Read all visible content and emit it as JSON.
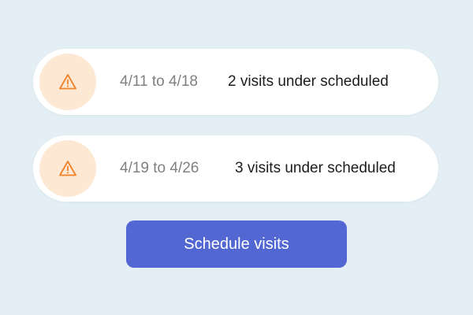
{
  "colors": {
    "background": "#e3eff4",
    "card": "#ffffff",
    "warning_icon": "#f0812a",
    "warning_badge": "#fde8d3",
    "button": "#5367d3",
    "button_text": "#ffffff"
  },
  "alerts": [
    {
      "icon": "warning-triangle-icon",
      "date_range": "4/11 to 4/18",
      "message": "2 visits under scheduled"
    },
    {
      "icon": "warning-triangle-icon",
      "date_range": "4/19 to 4/26",
      "message": "3 visits under scheduled"
    }
  ],
  "actions": {
    "schedule_label": "Schedule visits"
  }
}
